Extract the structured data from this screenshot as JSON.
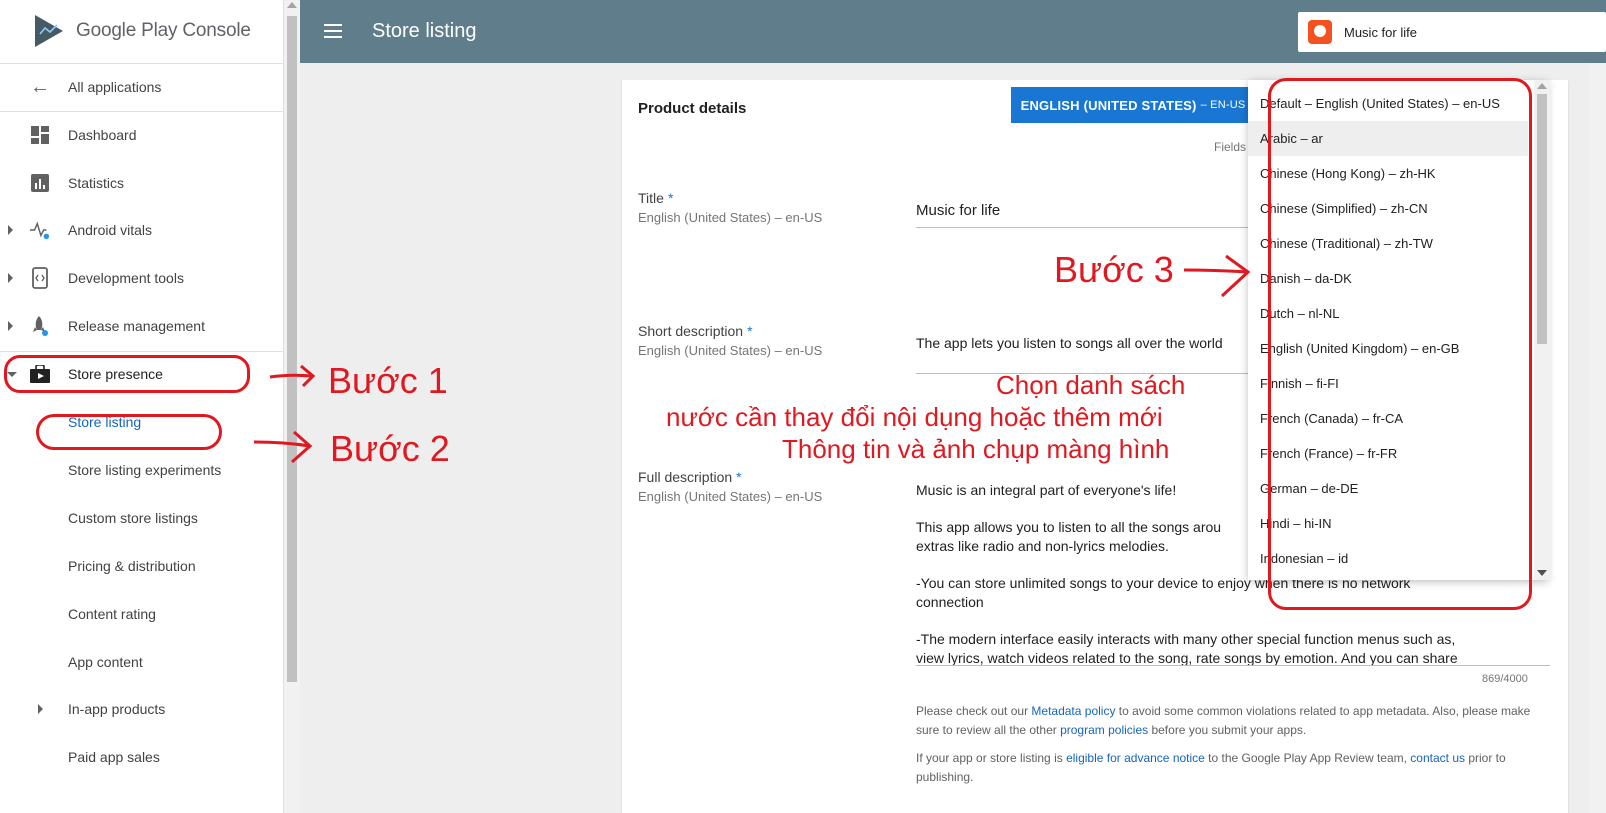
{
  "brand": {
    "name_part1": "Google Play",
    "name_part2": "Console"
  },
  "sidebar": {
    "items": [
      {
        "label": "All applications",
        "icon": "arrow-back-icon"
      },
      {
        "label": "Dashboard",
        "icon": "dashboard-icon"
      },
      {
        "label": "Statistics",
        "icon": "statistics-icon"
      },
      {
        "label": "Android vitals",
        "icon": "vitals-icon"
      },
      {
        "label": "Development tools",
        "icon": "dev-tools-icon"
      },
      {
        "label": "Release management",
        "icon": "rocket-icon"
      },
      {
        "label": "Store presence",
        "icon": "store-icon"
      },
      {
        "label": "Store listing"
      },
      {
        "label": "Store listing experiments"
      },
      {
        "label": "Custom store listings"
      },
      {
        "label": "Pricing & distribution"
      },
      {
        "label": "Content rating"
      },
      {
        "label": "App content"
      },
      {
        "label": "In-app products"
      },
      {
        "label": "Paid app sales"
      }
    ]
  },
  "topbar": {
    "title": "Store listing",
    "app_name": "Music for life"
  },
  "card": {
    "title": "Product details",
    "lang_button": {
      "label": "ENGLISH (UNITED STATES)",
      "code": "– EN-US"
    },
    "fields_note": "Fields m",
    "title_field": {
      "label": "Title",
      "star": "*",
      "lang": "English (United States) – en-US",
      "value": "Music for life"
    },
    "short_desc": {
      "label": "Short description",
      "star": "*",
      "lang": "English (United States) – en-US",
      "value": "The app lets you listen to songs all over the world"
    },
    "full_desc": {
      "label": "Full description",
      "star": "*",
      "lang": "English (United States) – en-US",
      "p1": "Music is an integral part of everyone's life!",
      "p2a": "This app allows you to listen to all the songs arou",
      "p2b": "extras like radio and non-lyrics melodies.",
      "p3a": "-You can store unlimited songs to your device to enjoy when there is no network",
      "p3b": "connection",
      "p4a": "-The modern interface easily interacts with many other special function menus such as,",
      "p4b": "view lyrics, watch videos related to the song, rate songs by emotion. And you can share",
      "counter": "869/4000"
    },
    "policy": {
      "t1": "Please check out our ",
      "l1": "Metadata policy",
      "t2": " to avoid some common violations related to app metadata. Also, please make sure to review all the other ",
      "l2": "program policies",
      "t3": " before you submit your apps.",
      "t4": "If your app or store listing is ",
      "l3": "eligible for advance notice",
      "t5": " to the Google Play App Review team, ",
      "l4": "contact us",
      "t6": " prior to publishing."
    }
  },
  "dropdown": {
    "options": [
      "Default – English (United States) – en-US",
      "Arabic – ar",
      "Chinese (Hong Kong) – zh-HK",
      "Chinese (Simplified) – zh-CN",
      "Chinese (Traditional) – zh-TW",
      "Danish – da-DK",
      "Dutch – nl-NL",
      "English (United Kingdom) – en-GB",
      "Finnish – fi-FI",
      "French (Canada) – fr-CA",
      "French (France) – fr-FR",
      "German – de-DE",
      "Hindi – hi-IN",
      "Indonesian – id"
    ]
  },
  "annotations": {
    "step1": "Bước  1",
    "step2": "Bước 2",
    "step3": "Bước 3",
    "line1": "Chọn danh sách",
    "line2": "nước cần thay đổi nội dụng hoặc thêm mới",
    "line3": "Thông tin và ảnh chụp màng hình",
    "color": "#e0181f"
  }
}
